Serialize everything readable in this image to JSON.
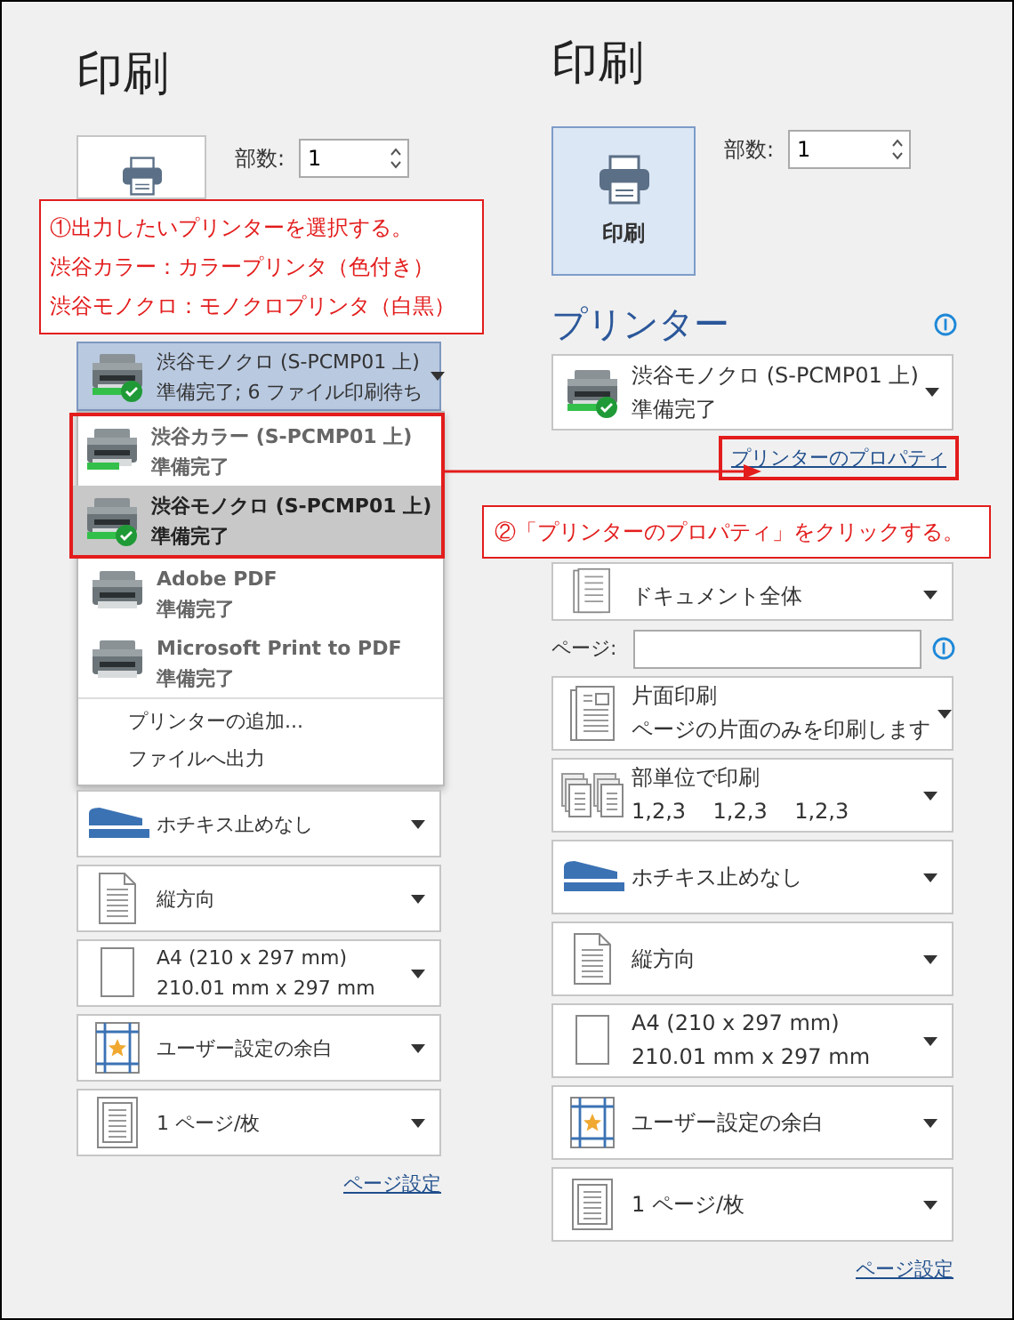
{
  "annotations": [
    {
      "kind": "callout",
      "lines": [
        "①出力したいプリンターを選択する。",
        "渋谷カラー：カラープリンタ（色付き）",
        "渋谷モノクロ：モノクロプリンタ（白黒）"
      ]
    },
    {
      "kind": "callout",
      "lines": [
        "②「プリンターのプロパティ」をクリックする。"
      ]
    },
    {
      "kind": "arrow"
    }
  ],
  "left_panel": {
    "title": "印刷",
    "print_button": {
      "selected": false
    },
    "copies": {
      "label": "部数:",
      "value": "1"
    },
    "printer_select": {
      "name": "渋谷モノクロ (S-PCMP01 上)",
      "status": "準備完了; 6 ファイル印刷待ち",
      "network": true,
      "default": true,
      "expanded": true
    },
    "printer_menu": {
      "printers": [
        {
          "name": "渋谷カラー (S-PCMP01 上)",
          "status": "準備完了",
          "network": true,
          "default": false,
          "selected": false,
          "annotated": true
        },
        {
          "name": "渋谷モノクロ (S-PCMP01 上)",
          "status": "準備完了",
          "network": true,
          "default": true,
          "selected": true,
          "annotated": true
        },
        {
          "name": "Adobe PDF",
          "status": "準備完了",
          "network": false,
          "default": false,
          "selected": false,
          "annotated": false
        },
        {
          "name": "Microsoft Print to PDF",
          "status": "準備完了",
          "network": false,
          "default": false,
          "selected": false,
          "annotated": false
        }
      ],
      "actions": [
        "プリンターの追加...",
        "ファイルへ出力"
      ]
    },
    "settings": [
      {
        "kind": "staple",
        "lines": [
          "ホチキス止めなし"
        ]
      },
      {
        "kind": "orientation",
        "lines": [
          "縦方向"
        ]
      },
      {
        "kind": "paper",
        "lines": [
          "A4 (210 x 297 mm)",
          "210.01 mm x 297 mm"
        ]
      },
      {
        "kind": "margins",
        "lines": [
          "ユーザー設定の余白"
        ]
      },
      {
        "kind": "per_sheet",
        "lines": [
          "1 ページ/枚"
        ]
      }
    ],
    "page_setup_link": "ページ設定"
  },
  "right_panel": {
    "title": "印刷",
    "print_button": {
      "label": "印刷",
      "selected": true
    },
    "copies": {
      "label": "部数:",
      "value": "1"
    },
    "printer_heading": "プリンター",
    "printer_select": {
      "name": "渋谷モノクロ (S-PCMP01 上)",
      "status": "準備完了",
      "network": true,
      "default": true,
      "expanded": false
    },
    "properties_link": {
      "text": "プリンターのプロパティ",
      "annotated": true
    },
    "settings": [
      {
        "kind": "pages",
        "lines": [
          "ドキュメント全体"
        ]
      },
      {
        "kind": "page_range",
        "label": "ページ:"
      },
      {
        "kind": "duplex",
        "lines": [
          "片面印刷",
          "ページの片面のみを印刷します"
        ]
      },
      {
        "kind": "collate",
        "lines": [
          "部単位で印刷",
          "1,2,3    1,2,3    1,2,3"
        ]
      },
      {
        "kind": "staple",
        "lines": [
          "ホチキス止めなし"
        ]
      },
      {
        "kind": "orientation",
        "lines": [
          "縦方向"
        ]
      },
      {
        "kind": "paper",
        "lines": [
          "A4 (210 x 297 mm)",
          "210.01 mm x 297 mm"
        ]
      },
      {
        "kind": "margins",
        "lines": [
          "ユーザー設定の余白"
        ]
      },
      {
        "kind": "per_sheet",
        "lines": [
          "1 ページ/枚"
        ]
      }
    ],
    "page_setup_link": "ページ設定"
  }
}
